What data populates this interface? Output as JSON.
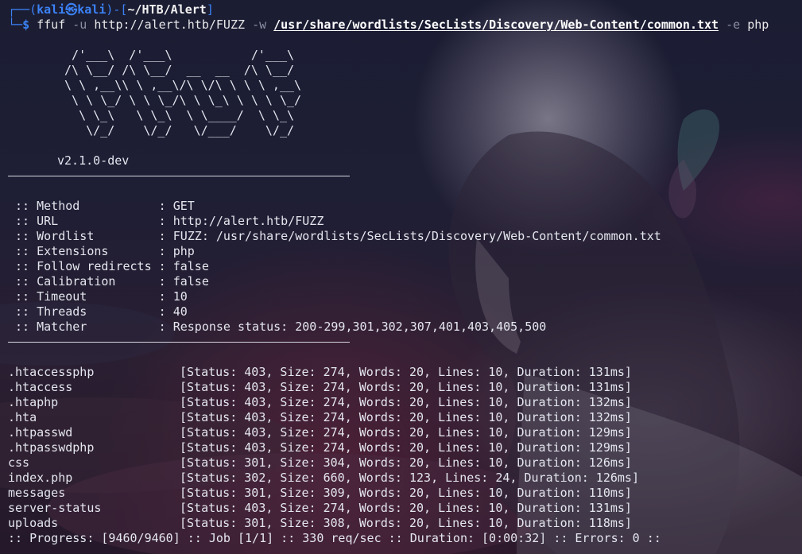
{
  "prompt": {
    "corner_top": "┌──(",
    "user": "kali㉿kali",
    "bracket_mid": ")-[",
    "path": "~/HTB/Alert",
    "bracket_end": "]",
    "corner_bottom": "└─",
    "dollar": "$"
  },
  "command": {
    "program": "ffuf",
    "flag_u": "-u",
    "url": "http://alert.htb/FUZZ",
    "flag_w": "-w",
    "wordlist": "/usr/share/wordlists/SecLists/Discovery/Web-Content/common.txt",
    "flag_e": "-e",
    "ext": "php"
  },
  "banner": [
    "  /'___\\  /'___\\           /'___\\",
    " /\\ \\__/ /\\ \\__/  __  __  /\\ \\__/",
    " \\ \\ ,__\\\\ \\ ,__\\/\\ \\/\\ \\ \\ \\ ,__\\",
    "  \\ \\ \\_/ \\ \\ \\_/\\ \\ \\_\\ \\ \\ \\ \\_/",
    "   \\ \\_\\   \\ \\_\\  \\ \\____/  \\ \\_\\",
    "    \\/_/    \\/_/   \\/___/    \\/_/"
  ],
  "version": "v2.1.0-dev",
  "options": [
    " :: Method           : GET",
    " :: URL              : http://alert.htb/FUZZ",
    " :: Wordlist         : FUZZ: /usr/share/wordlists/SecLists/Discovery/Web-Content/common.txt",
    " :: Extensions       : php",
    " :: Follow redirects : false",
    " :: Calibration      : false",
    " :: Timeout          : 10",
    " :: Threads          : 40",
    " :: Matcher          : Response status: 200-299,301,302,307,401,403,405,500"
  ],
  "results": [
    {
      "name": ".htaccessphp",
      "info": "[Status: 403, Size: 274, Words: 20, Lines: 10, Duration: 131ms]"
    },
    {
      "name": ".htaccess",
      "info": "[Status: 403, Size: 274, Words: 20, Lines: 10, Duration: 131ms]"
    },
    {
      "name": ".htaphp",
      "info": "[Status: 403, Size: 274, Words: 20, Lines: 10, Duration: 132ms]"
    },
    {
      "name": ".hta",
      "info": "[Status: 403, Size: 274, Words: 20, Lines: 10, Duration: 132ms]"
    },
    {
      "name": ".htpasswd",
      "info": "[Status: 403, Size: 274, Words: 20, Lines: 10, Duration: 129ms]"
    },
    {
      "name": ".htpasswdphp",
      "info": "[Status: 403, Size: 274, Words: 20, Lines: 10, Duration: 129ms]"
    },
    {
      "name": "css",
      "info": "[Status: 301, Size: 304, Words: 20, Lines: 10, Duration: 126ms]"
    },
    {
      "name": "index.php",
      "info": "[Status: 302, Size: 660, Words: 123, Lines: 24, Duration: 126ms]"
    },
    {
      "name": "messages",
      "info": "[Status: 301, Size: 309, Words: 20, Lines: 10, Duration: 110ms]"
    },
    {
      "name": "server-status",
      "info": "[Status: 403, Size: 274, Words: 20, Lines: 10, Duration: 131ms]"
    },
    {
      "name": "uploads",
      "info": "[Status: 301, Size: 308, Words: 20, Lines: 10, Duration: 118ms]"
    }
  ],
  "progress": ":: Progress: [9460/9460] :: Job [1/1] :: 330 req/sec :: Duration: [0:00:32] :: Errors: 0 ::",
  "colors": {
    "prompt_accent": "#3b82f6",
    "text": "#e4e6ee",
    "background": "#1b1d33"
  }
}
